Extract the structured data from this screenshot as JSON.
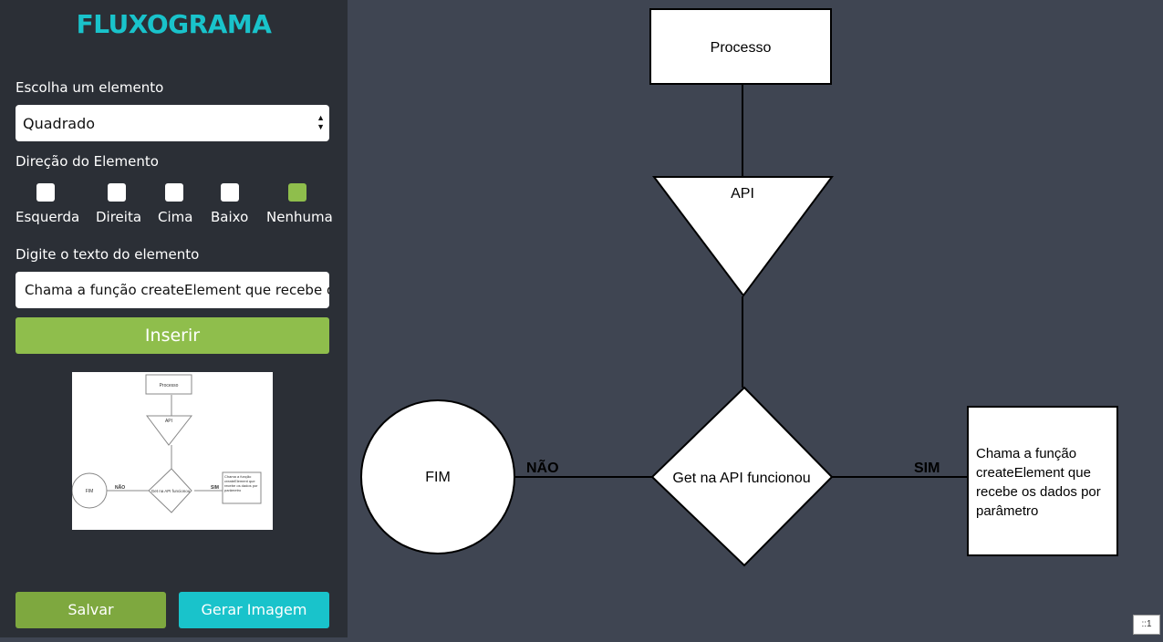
{
  "app": {
    "title": "FLUXOGRAMA"
  },
  "sidebar": {
    "element_label": "Escolha um elemento",
    "element_selected": "Quadrado",
    "direction_label": "Direção do Elemento",
    "directions": [
      {
        "label": "Esquerda",
        "checked": false
      },
      {
        "label": "Direita",
        "checked": false
      },
      {
        "label": "Cima",
        "checked": false
      },
      {
        "label": "Baixo",
        "checked": false
      },
      {
        "label": "Nenhuma",
        "checked": true
      }
    ],
    "text_label": "Digite o texto do elemento",
    "text_value": "Chama a função createElement que recebe os dados por parâmetro",
    "insert_button": "Inserir",
    "save_button": "Salvar",
    "generate_button": "Gerar Imagem"
  },
  "preview": {
    "process": "Processo",
    "api": "API",
    "end": "FIM",
    "decision": "Get na API funcionou",
    "no": "NÃO",
    "yes": "SIM",
    "action": "Chama a função createElement que recebe os dados por parâmetro"
  },
  "flowchart": {
    "process_text": "Processo",
    "api_text": "API",
    "decision_text": "Get na API funcionou",
    "end_text": "FIM",
    "no_label": "NÃO",
    "yes_label": "SIM",
    "action_lines": [
      "Chama a função",
      "createElement que",
      "recebe os dados por",
      "parâmetro"
    ]
  },
  "canvas": {
    "zoom_badge": "::1"
  },
  "colors": {
    "accent_cyan": "#19c3cb",
    "accent_green": "#8fbe4c",
    "save_green": "#7ea83f",
    "sidebar_bg": "#2b2f36",
    "canvas_bg": "#3f4552"
  }
}
